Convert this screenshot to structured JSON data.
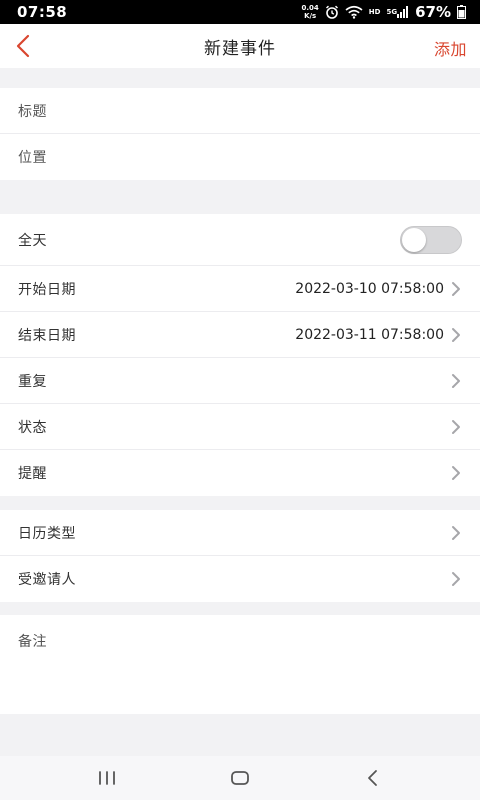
{
  "status_bar": {
    "time": "07:58",
    "net_speed_value": "0.04",
    "net_speed_unit": "K/s",
    "hd": "HD",
    "network": "5G",
    "battery": "67%"
  },
  "header": {
    "title": "新建事件",
    "add_label": "添加",
    "accent_color": "#d9462f"
  },
  "form": {
    "basic": [
      {
        "placeholder": "标题"
      },
      {
        "placeholder": "位置"
      }
    ],
    "all_day": {
      "label": "全天",
      "enabled": false
    },
    "start": {
      "label": "开始日期",
      "value": "2022-03-10 07:58:00"
    },
    "end": {
      "label": "结束日期",
      "value": "2022-03-11 07:58:00"
    },
    "repeat": {
      "label": "重复"
    },
    "status": {
      "label": "状态"
    },
    "reminder": {
      "label": "提醒"
    },
    "calendar_type": {
      "label": "日历类型"
    },
    "invitees": {
      "label": "受邀请人"
    },
    "notes": {
      "placeholder": "备注"
    }
  },
  "system_nav": {
    "icons": [
      "recent-apps-icon",
      "home-icon",
      "back-icon"
    ]
  }
}
